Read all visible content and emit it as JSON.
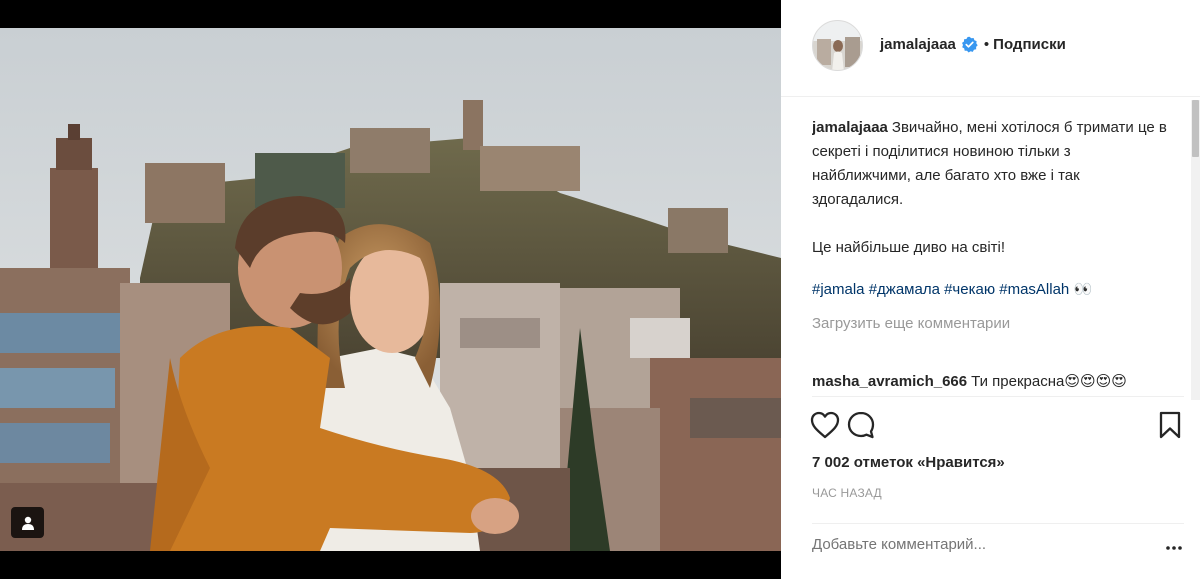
{
  "post": {
    "username": "jamalajaaa",
    "follow_label": "Подписки",
    "separator": "•",
    "caption_author": "jamalajaaa",
    "caption_text": "Звичайно, мені хотілося б тримати це в секреті і поділитися новиною тільки з найближчими, але багато хто вже і так здогадалися.\n\nЦе найбільше диво на світі!",
    "hashtags": "#jamala #джамала #чекаю #masAllah 👀",
    "load_more_label": "Загрузить еще комментарии",
    "comment_author": "masha_avramich_666",
    "comment_text": "Ти прекрасна😍😍😍😍",
    "likes_label": "7 002 отметок «Нравится»",
    "time_label": "ЧАС НАЗАД",
    "comment_placeholder": "Добавьте комментарий..."
  },
  "icons": {
    "verified": "verified-badge-icon",
    "like": "heart-icon",
    "comment": "comment-bubble-icon",
    "save": "bookmark-icon",
    "more": "more-options-icon",
    "user_tag": "user-tag-icon"
  },
  "colors": {
    "verified_blue": "#3897f0",
    "hashtag_blue": "#003569",
    "muted_gray": "#999999",
    "text": "#262626"
  }
}
